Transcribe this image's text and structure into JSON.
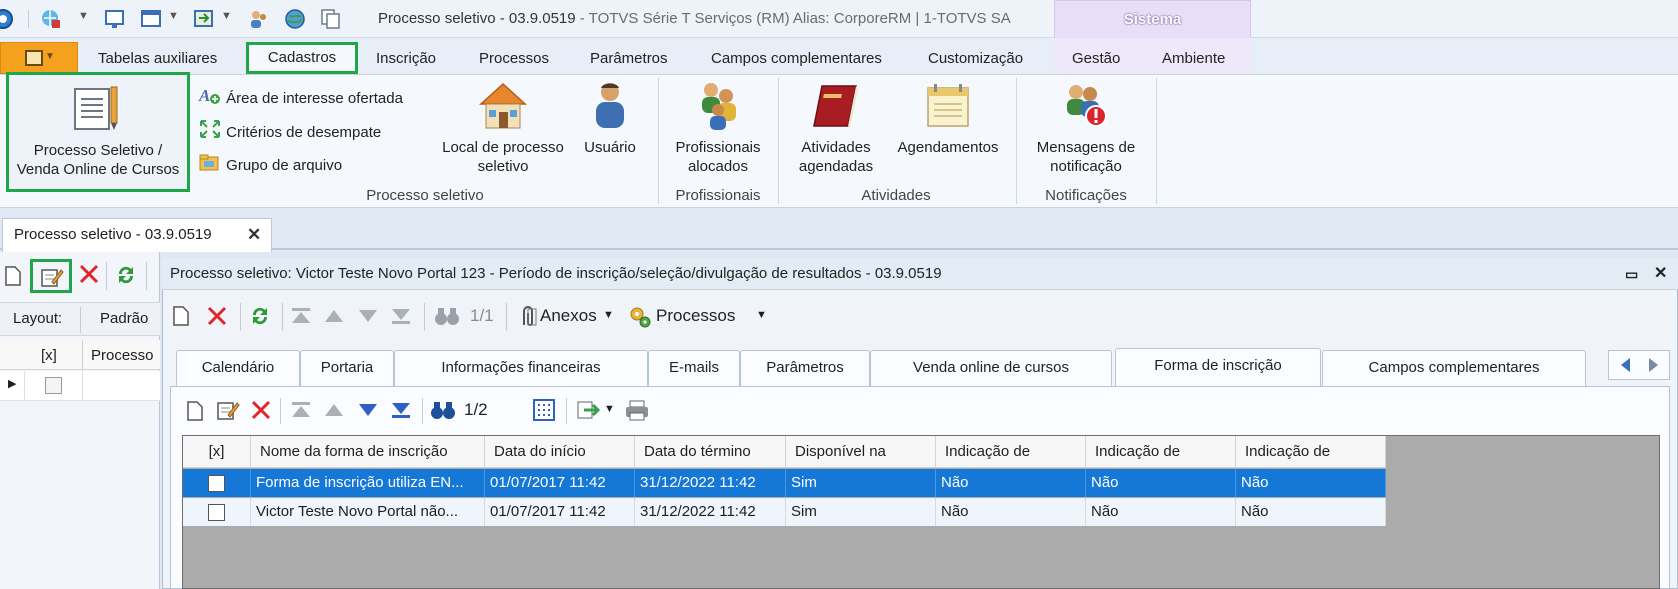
{
  "title": {
    "main": "Processo seletivo - 03.9.0519",
    "sub": " - TOTVS Série T Serviços (RM) Alias: CorporeRM | 1-TOTVS SA",
    "context_tab": "Sistema"
  },
  "ribbon_tabs": [
    "Tabelas auxiliares",
    "Cadastros",
    "Inscrição",
    "Processos",
    "Parâmetros",
    "Campos complementares",
    "Customização",
    "Gestão",
    "Ambiente"
  ],
  "ribbon": {
    "processo_seletivo_btn": [
      "Processo Seletivo /",
      "Venda Online de Cursos"
    ],
    "area_interesse": "Área de interesse ofertada",
    "criterios": "Critérios de desempate",
    "grupo_arquivo": "Grupo de arquivo",
    "local_processo": [
      "Local de processo",
      "seletivo"
    ],
    "usuario": "Usuário",
    "group_processo": "Processo seletivo",
    "profissionais_alocados": [
      "Profissionais",
      "alocados"
    ],
    "group_profissionais": "Profissionais",
    "atividades_agendadas": [
      "Atividades",
      "agendadas"
    ],
    "agendamentos": "Agendamentos",
    "group_atividades": "Atividades",
    "mensagens": [
      "Mensagens de",
      "notificação"
    ],
    "group_notificacoes": "Notificações"
  },
  "doc_tab": {
    "label": "Processo seletivo - 03.9.0519",
    "close": "✕"
  },
  "left": {
    "layout_label": "Layout:",
    "layout_value": "Padrão",
    "col_check": "[x]",
    "col_processo": "Processo"
  },
  "child": {
    "title": "Processo seletivo: Victor Teste Novo Portal 123 - Período de inscrição/seleção/divulgação de resultados - 03.9.0519",
    "pager": "1/1",
    "anexos": "Anexos",
    "processos": "Processos",
    "tabs": [
      "Calendário",
      "Portaria",
      "Informações financeiras",
      "E-mails",
      "Parâmetros",
      "Venda online de cursos",
      "Forma de inscrição",
      "Campos complementares"
    ],
    "grid_pager": "1/2"
  },
  "grid": {
    "headers": [
      "[x]",
      "Nome da forma de inscrição",
      "Data do início",
      "Data do término",
      "Disponível na",
      "Indicação de",
      "Indicação de",
      "Indicação de"
    ],
    "rows": [
      [
        "",
        "Forma de inscrição utiliza EN...",
        "01/07/2017 11:42",
        "31/12/2022 11:42",
        "Sim",
        "Não",
        "Não",
        "Não"
      ],
      [
        "",
        "Victor Teste Novo Portal não...",
        "01/07/2017 11:42",
        "31/12/2022 11:42",
        "Sim",
        "Não",
        "Não",
        "Não"
      ]
    ]
  },
  "colors": {
    "highlight": "#1fa64a",
    "selected_row": "#1678d6",
    "file_button": "#f4a21d"
  }
}
